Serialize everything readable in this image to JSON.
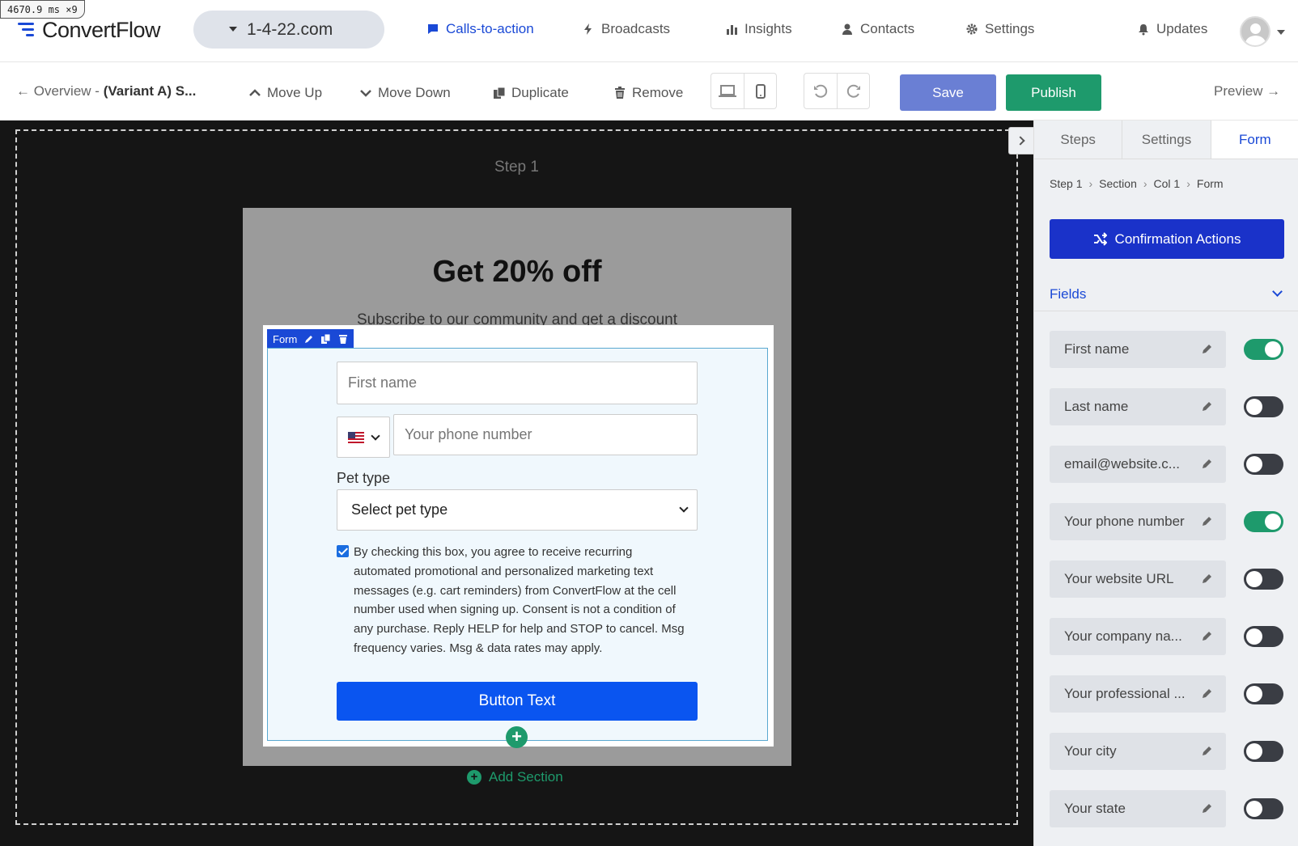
{
  "debug": "4670.9 ms ×9",
  "app": {
    "logo": "ConvertFlow",
    "domain": "1-4-22.com"
  },
  "nav": [
    {
      "label": "Calls-to-action",
      "icon": "chat-icon",
      "active": true
    },
    {
      "label": "Broadcasts",
      "icon": "bolt-icon"
    },
    {
      "label": "Insights",
      "icon": "bar-chart-icon"
    },
    {
      "label": "Contacts",
      "icon": "person-icon"
    },
    {
      "label": "Settings",
      "icon": "gear-icon"
    },
    {
      "label": "Updates",
      "icon": "bell-icon"
    }
  ],
  "toolbar": {
    "back_prefix": "← Overview - ",
    "back_variant": "(Variant A) S...",
    "move_up": "Move Up",
    "move_down": "Move Down",
    "duplicate": "Duplicate",
    "remove": "Remove",
    "save": "Save",
    "publish": "Publish",
    "preview": "Preview →"
  },
  "canvas": {
    "step_label": "Step 1",
    "headline": "Get 20% off",
    "subheadline": "Subscribe to our community and get a discount",
    "form_tag": "Form",
    "first_name_placeholder": "First name",
    "phone_placeholder": "Your phone number",
    "pet_label": "Pet type",
    "pet_select": "Select pet type",
    "consent": "By checking this box, you agree to receive recurring automated promotional and personalized marketing text messages (e.g. cart reminders) from ConvertFlow at the cell number used when signing up. Consent is not a condition of any purchase. Reply HELP for help and STOP to cancel. Msg frequency varies. Msg & data rates may apply.",
    "button_text": "Button Text",
    "add_section": "Add Section"
  },
  "panel": {
    "tabs": [
      "Steps",
      "Settings",
      "Form"
    ],
    "breadcrumb": [
      "Step 1",
      "Section",
      "Col 1",
      "Form"
    ],
    "confirm_actions": "Confirmation Actions",
    "fields_label": "Fields",
    "fields": [
      {
        "label": "First name",
        "enabled": true
      },
      {
        "label": "Last name",
        "enabled": false
      },
      {
        "label": "email@website.c...",
        "enabled": false
      },
      {
        "label": "Your phone number",
        "enabled": true
      },
      {
        "label": "Your website URL",
        "enabled": false
      },
      {
        "label": "Your company na...",
        "enabled": false
      },
      {
        "label": "Your professional ...",
        "enabled": false
      },
      {
        "label": "Your city",
        "enabled": false
      },
      {
        "label": "Your state",
        "enabled": false
      }
    ]
  },
  "colors": {
    "brand": "#1a49d6",
    "publish": "#1e9a6c",
    "save": "#6a7fd4",
    "cta": "#0a55f0"
  }
}
